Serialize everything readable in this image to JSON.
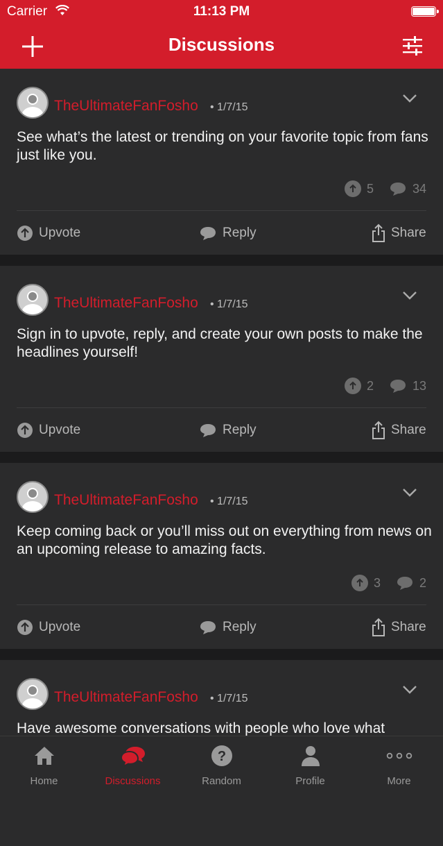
{
  "status_bar": {
    "carrier": "Carrier",
    "time": "11:13 PM"
  },
  "nav": {
    "title": "Discussions"
  },
  "posts": [
    {
      "username": "TheUltimateFanFosho",
      "date": "• 1/7/15",
      "text": "See what’s the latest or trending on your favorite topic from fans just like you.",
      "upvotes": "5",
      "comments": "34"
    },
    {
      "username": "TheUltimateFanFosho",
      "date": "• 1/7/15",
      "text": "Sign in to upvote, reply, and create your own posts to make the headlines yourself!",
      "upvotes": "2",
      "comments": "13"
    },
    {
      "username": "TheUltimateFanFosho",
      "date": "• 1/7/15",
      "text": "Keep coming back or you’ll miss out on everything from news on an upcoming release to amazing facts.",
      "upvotes": "3",
      "comments": "2"
    },
    {
      "username": "TheUltimateFanFosho",
      "date": "• 1/7/15",
      "text": "Have awesome conversations with people who love what",
      "upvotes": "",
      "comments": ""
    }
  ],
  "actions": {
    "upvote": "Upvote",
    "reply": "Reply",
    "share": "Share"
  },
  "tabs": [
    {
      "label": "Home",
      "icon": "home-icon"
    },
    {
      "label": "Discussions",
      "icon": "discussions-icon",
      "active": true
    },
    {
      "label": "Random",
      "icon": "question-icon"
    },
    {
      "label": "Profile",
      "icon": "profile-icon"
    },
    {
      "label": "More",
      "icon": "more-icon"
    }
  ],
  "colors": {
    "brand": "#d31d2b",
    "background": "#1b1b1c",
    "card": "#2b2b2c"
  }
}
